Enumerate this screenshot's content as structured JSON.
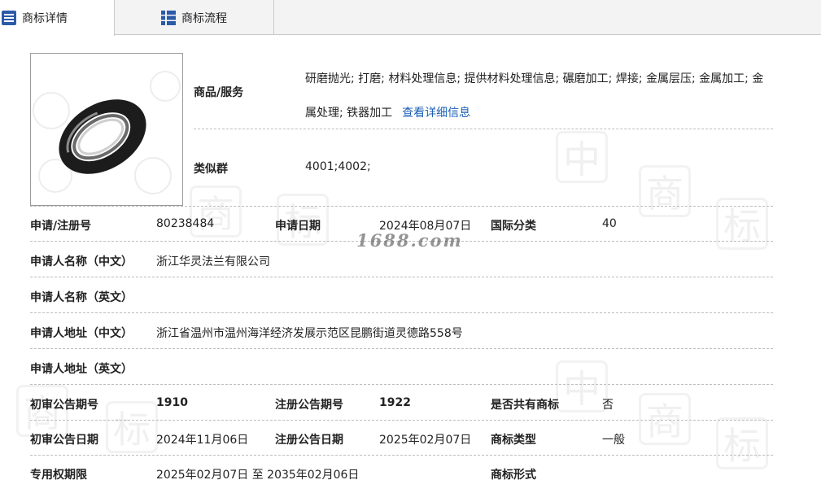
{
  "tabs": [
    {
      "label": "商标详情",
      "icon": "list-icon",
      "active": true
    },
    {
      "label": "商标流程",
      "icon": "grid-icon",
      "active": false
    }
  ],
  "watermark": {
    "site": "1688.com"
  },
  "goods_services": {
    "label": "商品/服务",
    "value": "研磨抛光; 打磨; 材料处理信息; 提供材料处理信息; 碾磨加工; 焊接; 金属层压; 金属加工; 金属处理; 铁器加工",
    "link": "查看详细信息"
  },
  "similar_group": {
    "label": "类似群",
    "value": "4001;4002;"
  },
  "fields": {
    "reg_no": {
      "label": "申请/注册号",
      "value": "80238484"
    },
    "apply_date": {
      "label": "申请日期",
      "value": "2024年08月07日"
    },
    "intl_class": {
      "label": "国际分类",
      "value": "40"
    },
    "applicant_cn": {
      "label": "申请人名称（中文）",
      "value": "浙江华灵法兰有限公司"
    },
    "applicant_en": {
      "label": "申请人名称（英文）",
      "value": ""
    },
    "address_cn": {
      "label": "申请人地址（中文）",
      "value": "浙江省温州市温州海洋经济发展示范区昆鹏街道灵德路558号"
    },
    "address_en": {
      "label": "申请人地址（英文）",
      "value": ""
    },
    "prelim_pub_no": {
      "label": "初审公告期号",
      "value": "1910"
    },
    "reg_pub_no": {
      "label": "注册公告期号",
      "value": "1922"
    },
    "shared_mark": {
      "label": "是否共有商标",
      "value": "否"
    },
    "prelim_pub_date": {
      "label": "初审公告日期",
      "value": "2024年11月06日"
    },
    "reg_pub_date": {
      "label": "注册公告日期",
      "value": "2025年02月07日"
    },
    "mark_type": {
      "label": "商标类型",
      "value": "一般"
    },
    "exclusive_period": {
      "label": "专用权期限",
      "value": "2025年02月07日 至 2035年02月06日"
    },
    "mark_form": {
      "label": "商标形式",
      "value": ""
    }
  },
  "colors": {
    "link": "#1a5fb4",
    "tab_icon": "#2b5aa8",
    "ring": "#1c1c1c"
  }
}
